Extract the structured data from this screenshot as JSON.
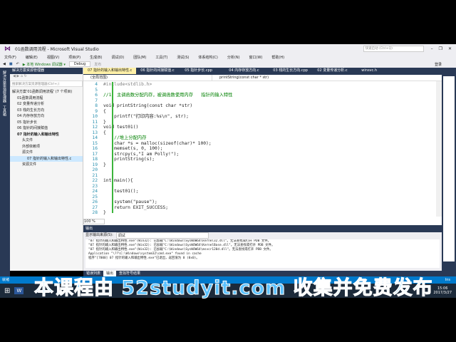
{
  "window": {
    "title": "01函数调用流程 - Microsoft Visual Studio",
    "quick_launch_placeholder": "快速启动 (Ctrl+Q)",
    "login": "登录"
  },
  "menu": [
    "文件(F)",
    "编辑(E)",
    "视图(V)",
    "项目(P)",
    "生成(B)",
    "调试(D)",
    "团队(M)",
    "工具(T)",
    "测试(S)",
    "体系结构(C)",
    "分析(N)",
    "窗口(W)",
    "帮助(H)"
  ],
  "toolbar": {
    "debugger": "▶ 本地 Windows 调试器 ▾",
    "config": "Debug",
    "publish": "发布"
  },
  "left_strip": [
    "解决方案资源管理器",
    "工具箱"
  ],
  "solution_explorer": {
    "title": "解决方案资源管理器",
    "search_placeholder": "搜索解决方案资源管理器(Ctrl+;)",
    "items": [
      {
        "label": "解决方案'01函数调用流程' (7 个项目)",
        "level": 0
      },
      {
        "label": "01函数调用流程",
        "level": 1
      },
      {
        "label": "02 变量传递分析",
        "level": 1
      },
      {
        "label": "03 栈的生长方向",
        "level": 1
      },
      {
        "label": "04 内存存放方向",
        "level": 1
      },
      {
        "label": "05 指针步长",
        "level": 1
      },
      {
        "label": "06 指针的间接赋值",
        "level": 1
      },
      {
        "label": "07 指针的输入和输出特性",
        "level": 1,
        "bold": true
      },
      {
        "label": "头文件",
        "level": 2
      },
      {
        "label": "外部依赖项",
        "level": 2
      },
      {
        "label": "源文件",
        "level": 2
      },
      {
        "label": "07 指针的输入和输出特性.c",
        "level": 3,
        "selected": true
      },
      {
        "label": "资源文件",
        "level": 2
      }
    ]
  },
  "editor": {
    "tabs": [
      {
        "label": "07 指针的输入和输出特性.c",
        "active": true
      },
      {
        "label": "06 指针的间接赋值.c"
      },
      {
        "label": "05 指针步长.cpp"
      },
      {
        "label": "04 内存存放方向.c"
      },
      {
        "label": "03 栈的生长方向.cpp"
      },
      {
        "label": "02 变量传递分析.c"
      },
      {
        "label": "winsvc.h"
      }
    ],
    "scope": "(全局范围)",
    "function": "printString(const char * str)",
    "zoom": "100 %",
    "lines": [
      {
        "n": "4",
        "t": "#include<stdlib.h>",
        "c": "pp"
      },
      {
        "n": "5",
        "t": ""
      },
      {
        "n": "6",
        "t": "//1. 主调函数分配内存，被调函数使用内存   指针的输入特性",
        "c": "cm"
      },
      {
        "n": "7",
        "t": ""
      },
      {
        "n": "8",
        "t": "void printString(const char *str)"
      },
      {
        "n": "9",
        "t": "{"
      },
      {
        "n": "10",
        "t": "    printf(\"打印内容:%s\\n\", str);"
      },
      {
        "n": "11",
        "t": "}"
      },
      {
        "n": "12",
        "t": "void test01()"
      },
      {
        "n": "13",
        "t": "{"
      },
      {
        "n": "14",
        "t": "    //堆上分配内存",
        "c": "cm"
      },
      {
        "n": "15",
        "t": "    char *s = malloc(sizeof(char)* 100);"
      },
      {
        "n": "16",
        "t": "    memset(s, 0, 100);"
      },
      {
        "n": "17",
        "t": "    strcpy(s,\"I am Polly!\");"
      },
      {
        "n": "18",
        "t": "    printString(s);"
      },
      {
        "n": "19",
        "t": "}"
      },
      {
        "n": "20",
        "t": ""
      },
      {
        "n": "21",
        "t": ""
      },
      {
        "n": "22",
        "t": "int main(){"
      },
      {
        "n": "23",
        "t": ""
      },
      {
        "n": "24",
        "t": "    test01();"
      },
      {
        "n": "25",
        "t": ""
      },
      {
        "n": "26",
        "t": "    system(\"pause\");"
      },
      {
        "n": "27",
        "t": "    return EXIT_SUCCESS;"
      },
      {
        "n": "28",
        "t": "}"
      }
    ]
  },
  "output": {
    "title": "输出",
    "source_label": "显示输出来源(S):",
    "source": "调试",
    "lines": [
      "\"07 指针的输入和输出特性.exe\"(Win32): 已加载\"C:\\Windows\\SysWOW64\\kernel32.dll\"。无法查找或打开 PDB 文件。",
      "\"07 指针的输入和输出特性.exe\"(Win32): 已加载\"C:\\Windows\\SysWOW64\\KernelBase.dll\"。无法查找或打开 PDB 文件。",
      "\"07 指针的输入和输出特性.exe\"(Win32): 已加载\"C:\\Windows\\SysWOW64\\msvcr120d.dll\"。无法查找或打开 PDB 文件。",
      "Application \"\\??\\C:\\Windows\\system32\\cmd.exe\" found in cache",
      "程序\"[7000] 07 指针的输入和输出特性.exe\"已退出，返回值为 0 (0x0)。"
    ]
  },
  "bottom_tabs": [
    "错误列表",
    "输出",
    "查找符号结果"
  ],
  "status": "就绪",
  "status_right": "Ins",
  "taskbar": {
    "time": "15:06",
    "date": "2017/3/27"
  },
  "watermark": "本课程由 52studyit.com 收集并免费发布"
}
